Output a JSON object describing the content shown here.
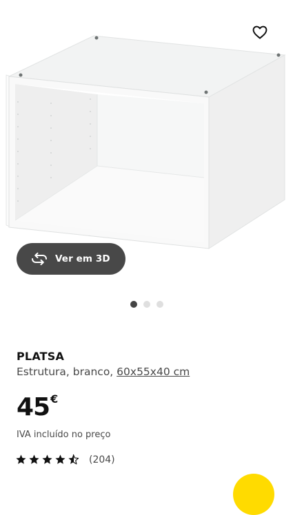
{
  "product": {
    "name": "PLATSA",
    "description_prefix": "Estrutura, branco,",
    "dimensions": "60x55x40 cm",
    "price": "45",
    "currency": "€",
    "vat_note": "IVA incluído no preço",
    "rating": 4.5,
    "rating_max": 5,
    "review_count": "(204)"
  },
  "gallery": {
    "view_3d_label": "Ver em 3D",
    "image_count": 3,
    "active_index": 0
  },
  "icons": {
    "favourite": "heart-outline-icon",
    "view_3d": "rotate-arrows-icon",
    "rating": "star-icon"
  },
  "colors": {
    "button_dark": "#484848",
    "dot_active": "#444444",
    "dot_inactive": "#dfdfdf",
    "cart_accent": "#ffdb00"
  }
}
